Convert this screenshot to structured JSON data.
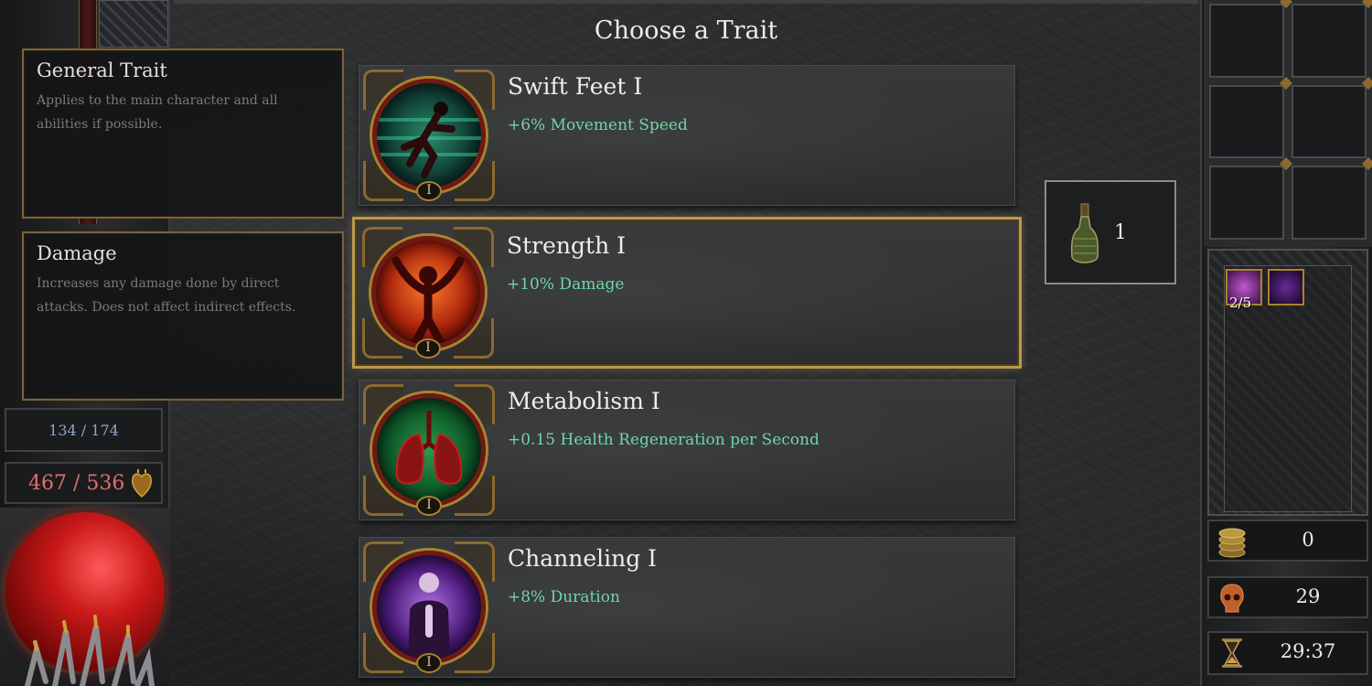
{
  "title": "Choose a Trait",
  "info_boxes": [
    {
      "title": "General Trait",
      "description": "Applies to the main character and all abilities if possible."
    },
    {
      "title": "Damage",
      "description": "Increases any damage done by direct attacks. Does not affect indirect effects."
    }
  ],
  "player_stats": {
    "mana": "134 / 174",
    "health": "467 / 536"
  },
  "traits": [
    {
      "name": "Swift Feet I",
      "effect": "+6% Movement Speed",
      "rank": "I",
      "icon": "running-figure-icon",
      "selected": false
    },
    {
      "name": "Strength I",
      "effect": "+10% Damage",
      "rank": "I",
      "icon": "strength-figure-icon",
      "selected": true
    },
    {
      "name": "Metabolism I",
      "effect": "+0.15 Health Regeneration per Second",
      "rank": "I",
      "icon": "lungs-icon",
      "selected": false
    },
    {
      "name": "Channeling I",
      "effect": "+8% Duration",
      "rank": "I",
      "icon": "praying-figure-icon",
      "selected": false
    }
  ],
  "potion": {
    "icon": "potion-bottle-icon",
    "count": "1"
  },
  "buffs": {
    "count_label": "2/5"
  },
  "counters": {
    "gold": "0",
    "kills": "29",
    "time": "29:37"
  },
  "colors": {
    "effect_text": "#6fd6a4",
    "selected_border": "#b89a4c",
    "health_text": "#e07070",
    "mana_text": "#8fa4c8"
  }
}
